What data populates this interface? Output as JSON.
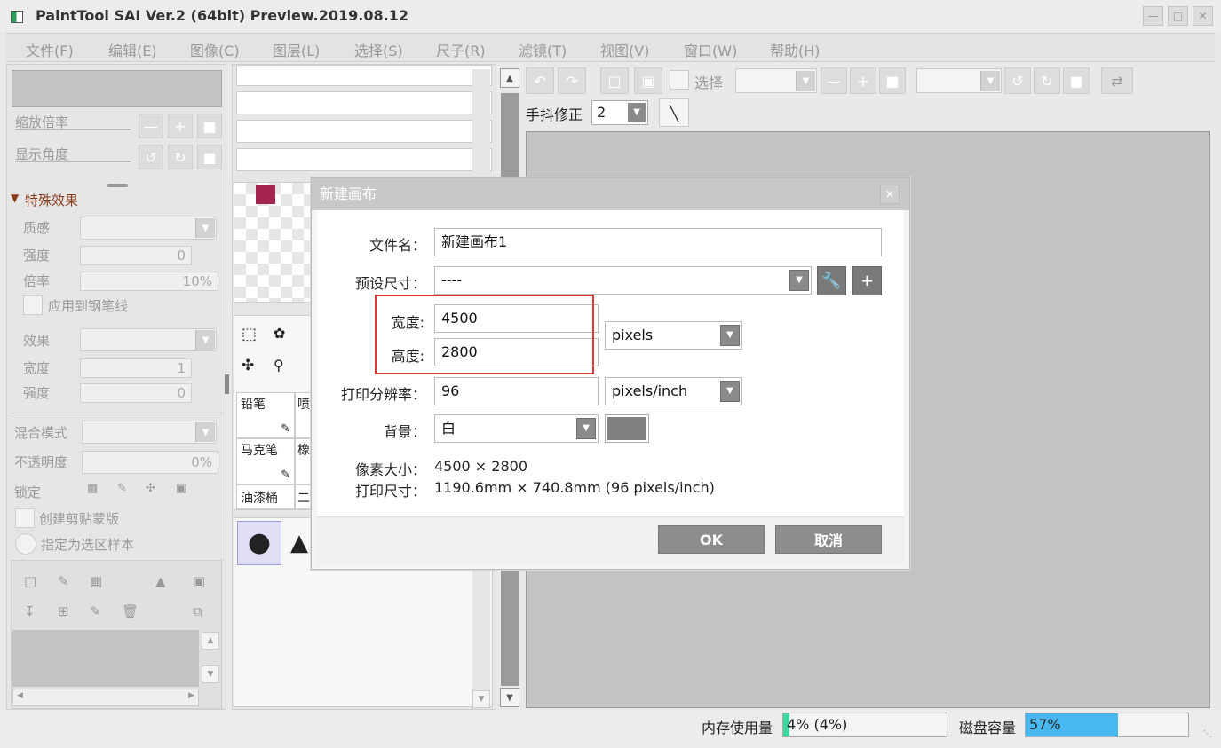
{
  "window": {
    "title": "PaintTool SAI Ver.2 (64bit) Preview.2019.08.12"
  },
  "menu": [
    "文件(F)",
    "编辑(E)",
    "图像(C)",
    "图层(L)",
    "选择(S)",
    "尺子(R)",
    "滤镜(T)",
    "视图(V)",
    "窗口(W)",
    "帮助(H)"
  ],
  "left_panel": {
    "zoom_label": "缩放倍率",
    "angle_label": "显示角度",
    "effects_title": "特殊效果",
    "texture_label": "质感",
    "strength_label": "强度",
    "strength_value": "0",
    "ratio_label": "倍率",
    "ratio_value": "10%",
    "apply_pen_label": "应用到钢笔线",
    "effect_label": "效果",
    "width_label": "宽度",
    "width_value": "1",
    "strength2_label": "强度",
    "strength2_value": "0",
    "blend_label": "混合模式",
    "opacity_label": "不透明度",
    "opacity_value": "0%",
    "lock_label": "锁定",
    "clip_label": "创建剪贴蒙版",
    "sample_label": "指定为选区样本"
  },
  "tools": {
    "pencil": "铅笔",
    "spray": "喷",
    "marker": "马克笔",
    "eraser": "橡",
    "bucket": "油漆桶",
    "binary": "二"
  },
  "toolbar": {
    "select_label": "选择",
    "stabilizer_label": "手抖修正",
    "stabilizer_value": "2",
    "stabilizer_options": [
      "2"
    ]
  },
  "dialog": {
    "title": "新建画布",
    "filename_label": "文件名：",
    "filename_value": "新建画布1",
    "preset_label": "预设尺寸：",
    "preset_value": "----",
    "width_label": "宽度:",
    "width_value": "4500",
    "height_label": "高度:",
    "height_value": "2800",
    "unit_value": "pixels",
    "dpi_label": "打印分辨率：",
    "dpi_value": "96",
    "dpi_unit": "pixels/inch",
    "bg_label": "背景：",
    "bg_value": "白",
    "pixel_size_label": "像素大小：",
    "pixel_size_value": "4500 × 2800",
    "print_size_label": "打印尺寸：",
    "print_size_value": "1190.6mm × 740.8mm (96 pixels/inch)",
    "ok_label": "OK",
    "cancel_label": "取消"
  },
  "status": {
    "memory_label": "内存使用量",
    "memory_text": "4% (4%)",
    "memory_fraction": 0.04,
    "disk_label": "磁盘容量",
    "disk_text": "57%",
    "disk_fraction": 0.57
  },
  "colors": {
    "accent_red": "#e0383a",
    "memory_bar": "#3fd6a0",
    "disk_bar": "#4ab8f0",
    "swatch": "#a3244d",
    "bg_swatch": "#808080"
  }
}
